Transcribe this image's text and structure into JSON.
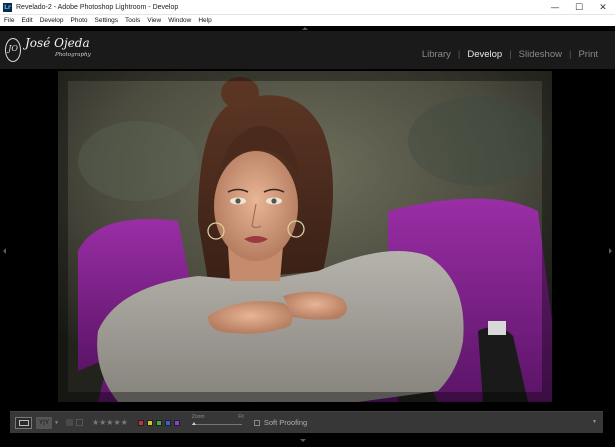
{
  "window": {
    "title": "Revelado-2 - Adobe Photoshop Lightroom - Develop",
    "app_icon": "Lr",
    "controls": {
      "minimize": "—",
      "maximize": "☐",
      "close": "✕"
    }
  },
  "menu": [
    {
      "label": "File"
    },
    {
      "label": "Edit"
    },
    {
      "label": "Develop"
    },
    {
      "label": "Photo"
    },
    {
      "label": "Settings"
    },
    {
      "label": "Tools"
    },
    {
      "label": "View"
    },
    {
      "label": "Window"
    },
    {
      "label": "Help"
    }
  ],
  "logo": {
    "monogram": "JO",
    "name": "José Ojeda",
    "sub": "Photography"
  },
  "modules": [
    {
      "label": "Library"
    },
    {
      "label": "Develop",
      "active": true
    },
    {
      "label": "Slideshow"
    },
    {
      "label": "Print"
    }
  ],
  "toolbar": {
    "loupe_icon": "loupe-view-icon",
    "compare_label": "Y|Y",
    "rating": "★★★★★",
    "color_labels": [
      "#c83232",
      "#d6c12a",
      "#3fae3f",
      "#3a5fd0",
      "#8a3ed0"
    ],
    "zoom_label": "Zoom",
    "zoom_fit": "Fit",
    "soft_proofing": "Soft Proofing"
  },
  "colors": {
    "accent": "#8a2a9a",
    "background": "#000000",
    "panel": "#373737"
  }
}
